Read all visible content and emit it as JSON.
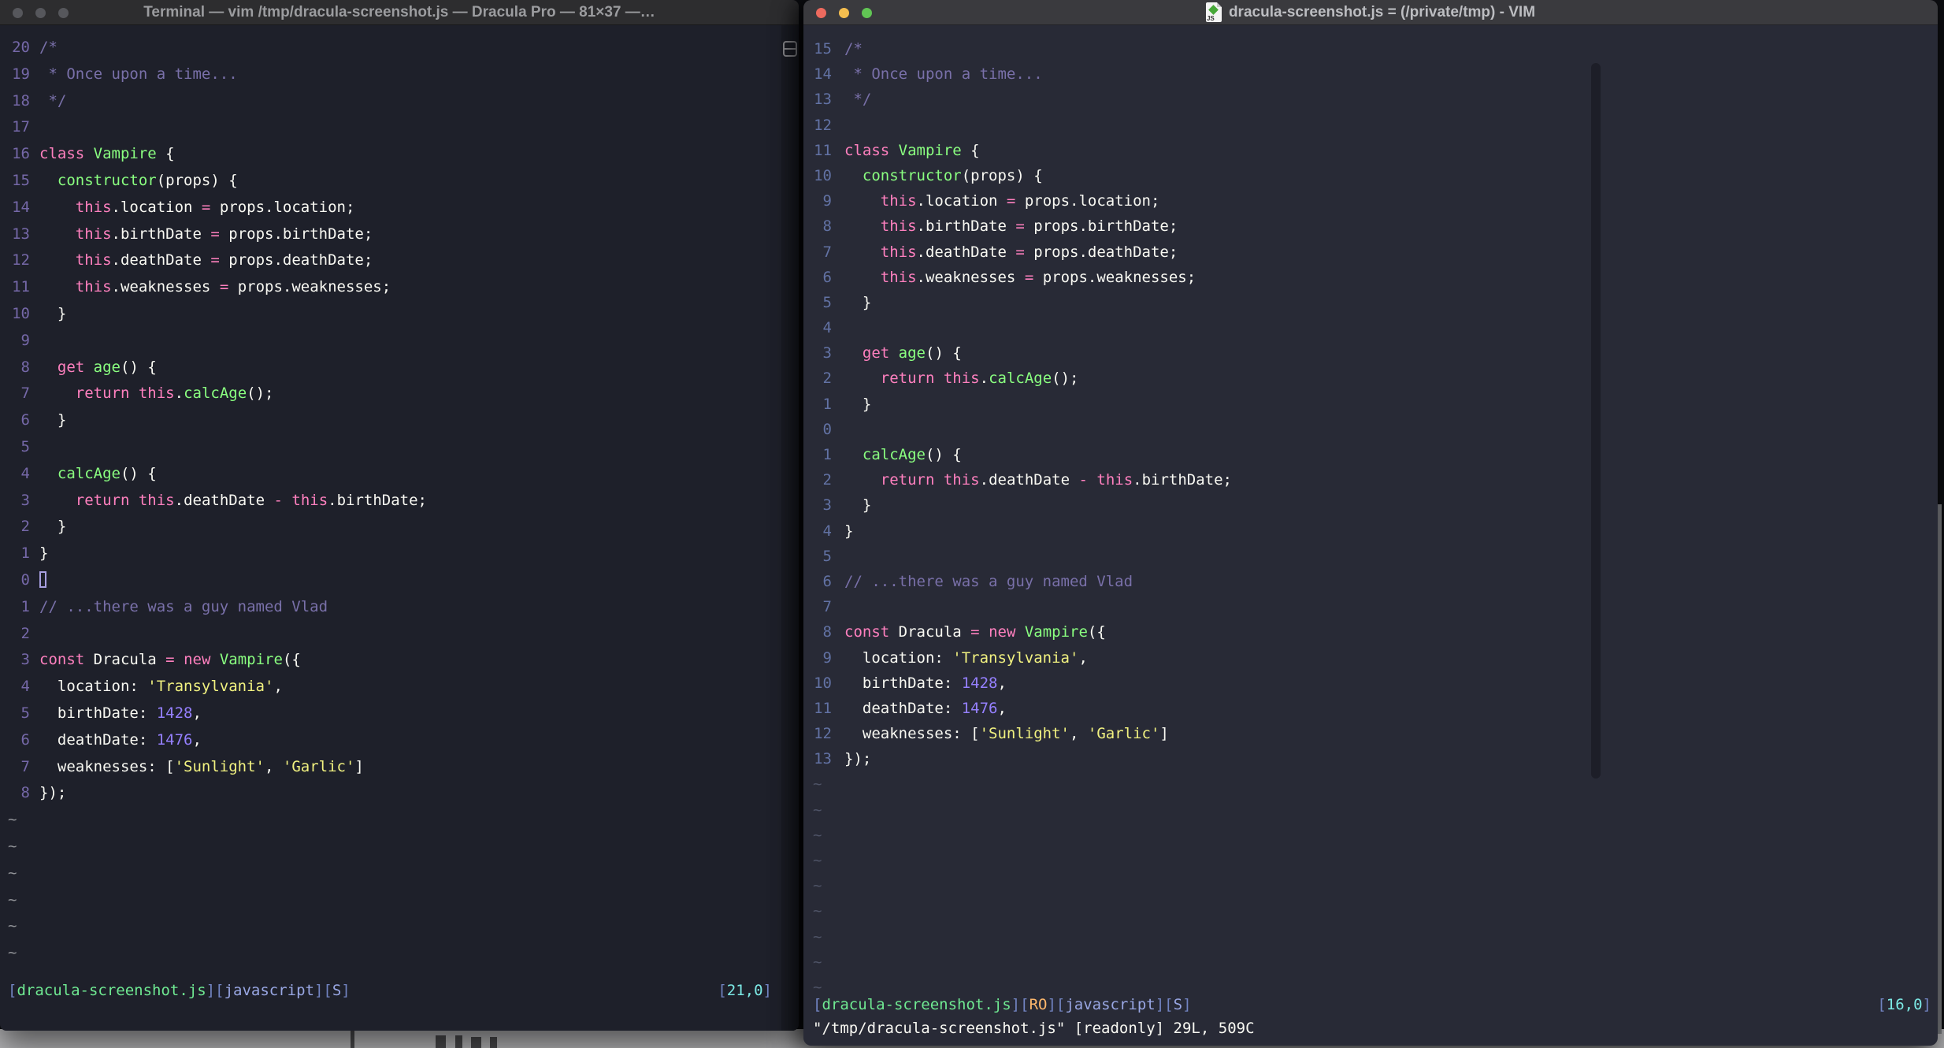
{
  "colors": {
    "bg_left": "#1e202a",
    "bg_right": "#282a36",
    "titlebar_left": "#2d2d2f",
    "titlebar_right": "#3a3a3e",
    "title_text_left": "#9b9c9f",
    "title_text_right": "#bcbdc1",
    "comment": "#7970a9",
    "pink": "#ff80bf",
    "green": "#8aff80",
    "yellow": "#f1f180",
    "purple": "#9580ff",
    "fg": "#f8f8f2",
    "linenr_left": "#7568a8",
    "linenr_right": "#6272a4",
    "tilde_left": "#8f9196",
    "tilde_right": "#4e5366",
    "bracket": "#7284c2",
    "blue": "#99a7e4",
    "cyan": "#7ce9e5",
    "orange": "#ffb86c",
    "sgreen": "#6fe992",
    "cursor_outline": "#a79fe0",
    "traffic_gray": "#56575c",
    "traffic_red": "#ed6a5e",
    "traffic_yellow": "#f5be4f",
    "traffic_green": "#61c554",
    "desktop": "#b6b6b8",
    "scroll_track_left": "#1a1c24",
    "scroll_thumb_right": "#1d1e28"
  },
  "code_lines": [
    [
      {
        "t": "comment",
        "s": "/*"
      }
    ],
    [
      {
        "t": "comment",
        "s": " * Once upon a time..."
      }
    ],
    [
      {
        "t": "comment",
        "s": " */"
      }
    ],
    [],
    [
      {
        "t": "pink",
        "s": "class"
      },
      {
        "t": "fg",
        "s": " "
      },
      {
        "t": "green",
        "s": "Vampire"
      },
      {
        "t": "fg",
        "s": " {"
      }
    ],
    [
      {
        "t": "fg",
        "s": "  "
      },
      {
        "t": "green",
        "s": "constructor"
      },
      {
        "t": "fg",
        "s": "(props) {"
      }
    ],
    [
      {
        "t": "fg",
        "s": "    "
      },
      {
        "t": "pink",
        "s": "this"
      },
      {
        "t": "fg",
        "s": ".location "
      },
      {
        "t": "pink",
        "s": "="
      },
      {
        "t": "fg",
        "s": " props.location;"
      }
    ],
    [
      {
        "t": "fg",
        "s": "    "
      },
      {
        "t": "pink",
        "s": "this"
      },
      {
        "t": "fg",
        "s": ".birthDate "
      },
      {
        "t": "pink",
        "s": "="
      },
      {
        "t": "fg",
        "s": " props.birthDate;"
      }
    ],
    [
      {
        "t": "fg",
        "s": "    "
      },
      {
        "t": "pink",
        "s": "this"
      },
      {
        "t": "fg",
        "s": ".deathDate "
      },
      {
        "t": "pink",
        "s": "="
      },
      {
        "t": "fg",
        "s": " props.deathDate;"
      }
    ],
    [
      {
        "t": "fg",
        "s": "    "
      },
      {
        "t": "pink",
        "s": "this"
      },
      {
        "t": "fg",
        "s": ".weaknesses "
      },
      {
        "t": "pink",
        "s": "="
      },
      {
        "t": "fg",
        "s": " props.weaknesses;"
      }
    ],
    [
      {
        "t": "fg",
        "s": "  }"
      }
    ],
    [],
    [
      {
        "t": "fg",
        "s": "  "
      },
      {
        "t": "pink",
        "s": "get"
      },
      {
        "t": "fg",
        "s": " "
      },
      {
        "t": "green",
        "s": "age"
      },
      {
        "t": "fg",
        "s": "() {"
      }
    ],
    [
      {
        "t": "fg",
        "s": "    "
      },
      {
        "t": "pink",
        "s": "return"
      },
      {
        "t": "fg",
        "s": " "
      },
      {
        "t": "pink",
        "s": "this"
      },
      {
        "t": "fg",
        "s": "."
      },
      {
        "t": "green",
        "s": "calcAge"
      },
      {
        "t": "fg",
        "s": "();"
      }
    ],
    [
      {
        "t": "fg",
        "s": "  }"
      }
    ],
    [],
    [
      {
        "t": "fg",
        "s": "  "
      },
      {
        "t": "green",
        "s": "calcAge"
      },
      {
        "t": "fg",
        "s": "() {"
      }
    ],
    [
      {
        "t": "fg",
        "s": "    "
      },
      {
        "t": "pink",
        "s": "return"
      },
      {
        "t": "fg",
        "s": " "
      },
      {
        "t": "pink",
        "s": "this"
      },
      {
        "t": "fg",
        "s": ".deathDate "
      },
      {
        "t": "pink",
        "s": "-"
      },
      {
        "t": "fg",
        "s": " "
      },
      {
        "t": "pink",
        "s": "this"
      },
      {
        "t": "fg",
        "s": ".birthDate;"
      }
    ],
    [
      {
        "t": "fg",
        "s": "  }"
      }
    ],
    [
      {
        "t": "fg",
        "s": "}"
      }
    ],
    [],
    [
      {
        "t": "comment",
        "s": "// ...there was a guy named Vlad"
      }
    ],
    [],
    [
      {
        "t": "pink",
        "s": "const"
      },
      {
        "t": "fg",
        "s": " Dracula "
      },
      {
        "t": "pink",
        "s": "="
      },
      {
        "t": "fg",
        "s": " "
      },
      {
        "t": "pink",
        "s": "new"
      },
      {
        "t": "fg",
        "s": " "
      },
      {
        "t": "green",
        "s": "Vampire"
      },
      {
        "t": "fg",
        "s": "({"
      }
    ],
    [
      {
        "t": "fg",
        "s": "  location: "
      },
      {
        "t": "yellow",
        "s": "'Transylvania'"
      },
      {
        "t": "fg",
        "s": ","
      }
    ],
    [
      {
        "t": "fg",
        "s": "  birthDate: "
      },
      {
        "t": "purple",
        "s": "1428"
      },
      {
        "t": "fg",
        "s": ","
      }
    ],
    [
      {
        "t": "fg",
        "s": "  deathDate: "
      },
      {
        "t": "purple",
        "s": "1476"
      },
      {
        "t": "fg",
        "s": ","
      }
    ],
    [
      {
        "t": "fg",
        "s": "  weaknesses: ["
      },
      {
        "t": "yellow",
        "s": "'Sunlight'"
      },
      {
        "t": "fg",
        "s": ", "
      },
      {
        "t": "yellow",
        "s": "'Garlic'"
      },
      {
        "t": "fg",
        "s": "]"
      }
    ],
    [
      {
        "t": "fg",
        "s": "});"
      }
    ]
  ],
  "left_window": {
    "title": "Terminal — vim /tmp/dracula-screenshot.js — Dracula Pro — 81×37 —…",
    "line_numbers": [
      "20",
      "19",
      "18",
      "17",
      "16",
      "15",
      "14",
      "13",
      "12",
      "11",
      "10",
      "9",
      "8",
      "7",
      "6",
      "5",
      "4",
      "3",
      "2",
      "1",
      "0",
      "1",
      "2",
      "3",
      "4",
      "5",
      "6",
      "7",
      "8"
    ],
    "cursor_row_index": 20,
    "tilde_char": "~",
    "tilde_rows": 6,
    "status_left": [
      {
        "t": "bracket",
        "s": "["
      },
      {
        "t": "sgreen",
        "s": "dracula-screenshot.js"
      },
      {
        "t": "bracket",
        "s": "]["
      },
      {
        "t": "blue",
        "s": "javascript"
      },
      {
        "t": "bracket",
        "s": "]["
      },
      {
        "t": "blue",
        "s": "S"
      },
      {
        "t": "bracket",
        "s": "]"
      }
    ],
    "status_right": [
      {
        "t": "bracket",
        "s": "["
      },
      {
        "t": "cyan",
        "s": "21,0"
      },
      {
        "t": "bracket",
        "s": "]"
      }
    ],
    "command_line": ""
  },
  "right_window": {
    "title": "dracula-screenshot.js = (/private/tmp) - VIM",
    "file_icon_label": "JS",
    "line_numbers": [
      "15",
      "14",
      "13",
      "12",
      "11",
      "10",
      "9",
      "8",
      "7",
      "6",
      "5",
      "4",
      "3",
      "2",
      "1",
      "0",
      "1",
      "2",
      "3",
      "4",
      "5",
      "6",
      "7",
      "8",
      "9",
      "10",
      "11",
      "12",
      "13"
    ],
    "tilde_char": "~",
    "tilde_rows": 9,
    "status_left": [
      {
        "t": "bracket",
        "s": "["
      },
      {
        "t": "sgreen",
        "s": "dracula-screenshot.js"
      },
      {
        "t": "bracket",
        "s": "]["
      },
      {
        "t": "orange",
        "s": "RO"
      },
      {
        "t": "bracket",
        "s": "]["
      },
      {
        "t": "blue",
        "s": "javascript"
      },
      {
        "t": "bracket",
        "s": "]["
      },
      {
        "t": "blue",
        "s": "S"
      },
      {
        "t": "bracket",
        "s": "]"
      }
    ],
    "status_right": [
      {
        "t": "bracket",
        "s": "["
      },
      {
        "t": "cyan",
        "s": "16,0"
      },
      {
        "t": "bracket",
        "s": "]"
      }
    ],
    "command_line": "\"/tmp/dracula-screenshot.js\" [readonly] 29L, 509C"
  }
}
